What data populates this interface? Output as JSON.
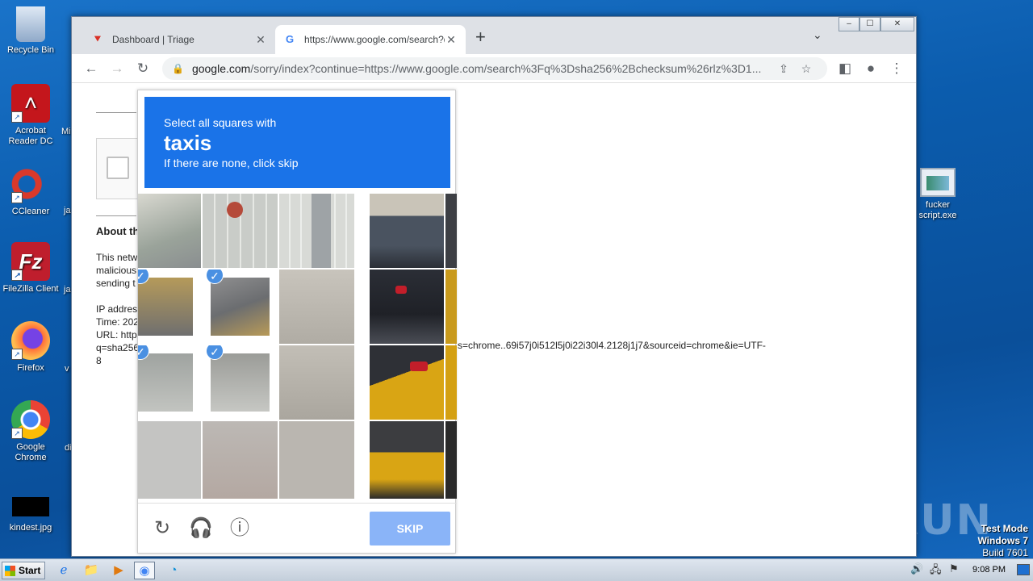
{
  "desktop": {
    "icons": [
      {
        "label": "Recycle Bin",
        "icon": "recycle-bin-icon",
        "color": "#9fb7d6"
      },
      {
        "label": "Acrobat Reader DC",
        "icon": "acrobat-icon",
        "color": "#c4161c"
      },
      {
        "label": "CCleaner",
        "icon": "ccleaner-icon",
        "color": "#d9392b"
      },
      {
        "label": "FileZilla Client",
        "icon": "filezilla-icon",
        "color": "#bf1e2d"
      },
      {
        "label": "Firefox",
        "icon": "firefox-icon",
        "color": "#ff7139"
      },
      {
        "label": "Google Chrome",
        "icon": "chrome-icon",
        "color": "#4285f4"
      },
      {
        "label": "kindest.jpg",
        "icon": "image-file-icon",
        "color": "#000000"
      },
      {
        "label": "fucker script.exe",
        "icon": "exe-file-icon",
        "color": "#e8eef5"
      }
    ],
    "partial_labels": [
      "Mi",
      "ja",
      "ja",
      "v",
      "di"
    ],
    "watermark": "ANY RUN",
    "testmode": {
      "line1": "Test Mode",
      "line2": "Windows 7",
      "line3": "Build 7601"
    }
  },
  "browser": {
    "tabs": [
      {
        "label": "Dashboard | Triage",
        "active": false
      },
      {
        "label": "https://www.google.com/search?q=",
        "active": true
      }
    ],
    "address": {
      "domain": "google.com",
      "path": "/sorry/index?continue=https://www.google.com/search%3Fq%3Dsha256%2Bchecksum%26rlz%3D1..."
    },
    "page": {
      "about_heading": "About th",
      "para_lines": [
        "This netw",
        "malicious",
        "sending t"
      ],
      "info_lines": [
        "IP addres",
        "Time: 202",
        "URL: http",
        "q=sha256",
        "8"
      ],
      "url_tail": "s=chrome..69i57j0i512l5j0i22i30l4.2128j1j7&sourceid=chrome&ie=UTF-"
    }
  },
  "captcha": {
    "instruction": "Select all squares with",
    "target": "taxis",
    "hint": "If there are none, click skip",
    "skip_label": "SKIP",
    "selected_tiles": 4
  },
  "taskbar": {
    "start_label": "Start",
    "clock": "9:08 PM"
  }
}
